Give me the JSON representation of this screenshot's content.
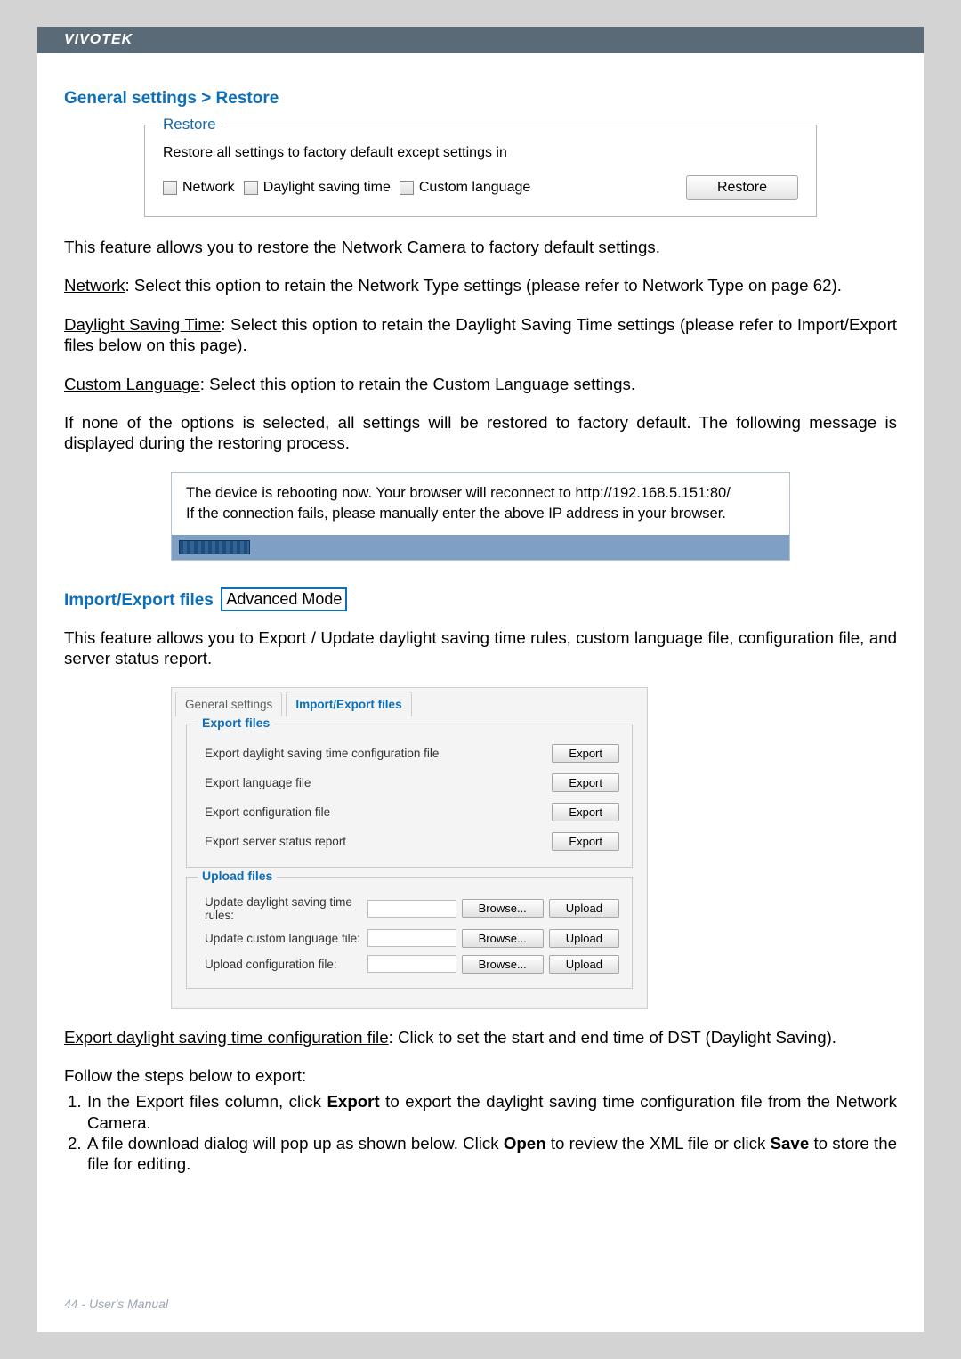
{
  "brand": "VIVOTEK",
  "section1_title": "General settings > Restore",
  "restore_fs": {
    "legend": "Restore",
    "intro": "Restore all settings to factory default except settings in",
    "cb_network": "Network",
    "cb_dst": "Daylight saving time",
    "cb_lang": "Custom language",
    "btn": "Restore"
  },
  "p1": "This feature allows you to restore the Network Camera to factory default settings.",
  "p2a": "Network",
  "p2b": ": Select this option to retain the Network Type settings (please refer to Network Type on page 62).",
  "p3a": "Daylight Saving Time",
  "p3b": ": Select this option to retain the Daylight Saving Time settings (please refer to Import/Export files below on this page).",
  "p4a": "Custom Language",
  "p4b": ": Select this option to retain the Custom Language settings.",
  "p5": "If none of the options is selected, all settings will be restored to factory default.  The following message is displayed during the restoring process.",
  "reboot1": "The device is rebooting now. Your browser will reconnect to http://192.168.5.151:80/",
  "reboot2": "If the connection fails, please manually enter the above IP address in your browser.",
  "section2_title": "Import/Export files",
  "adv_mode": "Advanced Mode",
  "p6": "This feature allows you to Export / Update daylight saving time rules, custom language file, configuration file, and server status report.",
  "tabs": {
    "t1": "General settings",
    "t2": "Import/Export files"
  },
  "export_fs": {
    "legend": "Export files",
    "r1": "Export daylight saving time configuration file",
    "r2": "Export language file",
    "r3": "Export configuration file",
    "r4": "Export server status report",
    "btn": "Export"
  },
  "upload_fs": {
    "legend": "Upload files",
    "r1": "Update daylight saving time rules:",
    "r2": "Update custom language file:",
    "r3": "Upload configuration file:",
    "browse": "Browse...",
    "upload": "Upload"
  },
  "p7a": "Export daylight saving time configuration file",
  "p7b": ": Click to set the start and end time of DST (Daylight Saving).",
  "p8": "Follow the steps below to export:",
  "ol1a": "In the Export files column, click ",
  "ol1b": "Export",
  "ol1c": " to export the daylight saving time configuration file from the Network Camera.",
  "ol2a": "A file download dialog will pop up as shown below. Click ",
  "ol2b": "Open",
  "ol2c": " to review the XML file or click ",
  "ol2d": "Save",
  "ol2e": " to store the file for editing.",
  "footer": "44 - User's Manual"
}
